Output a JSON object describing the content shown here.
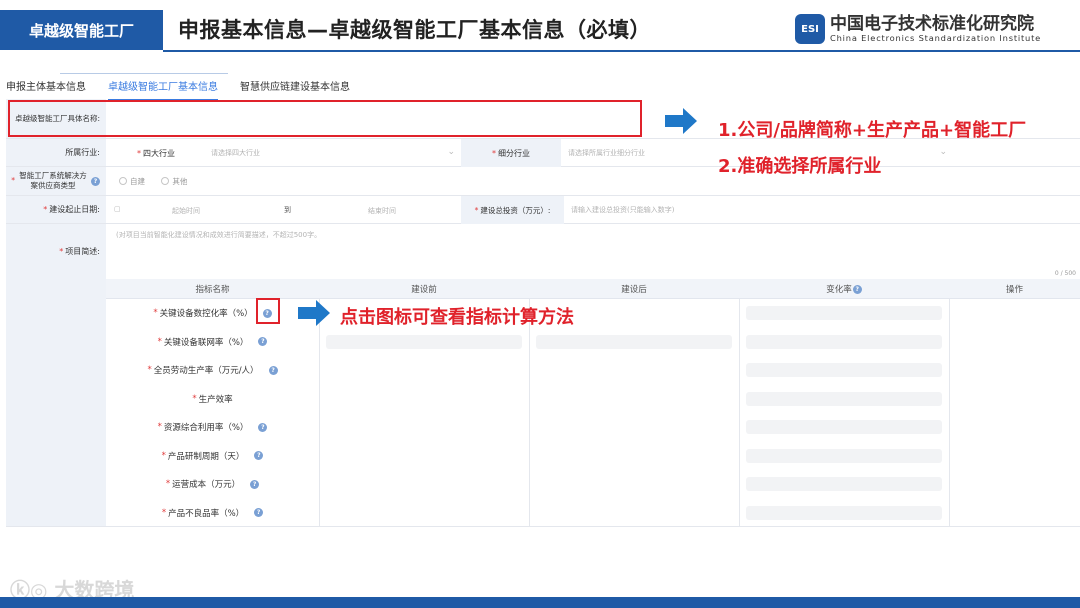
{
  "header": {
    "section_label": "卓越级智能工厂",
    "title": "申报基本信息—卓越级智能工厂基本信息（必填）",
    "logo_badge": "ESI",
    "logo_cn": "中国电子技术标准化研究院",
    "logo_en": "China Electronics Standardization Institute"
  },
  "tabs": [
    {
      "label": "申报主体基本信息",
      "active": false
    },
    {
      "label": "卓越级智能工厂基本信息",
      "active": true
    },
    {
      "label": "智慧供应链建设基本信息",
      "active": false
    }
  ],
  "form": {
    "factory_name_label": "卓越级智能工厂具体名称:",
    "industry_label": "所属行业:",
    "four_industry_label": "四大行业",
    "four_industry_placeholder": "请选择四大行业",
    "sub_industry_label": "细分行业",
    "sub_industry_placeholder": "请选择所属行业细分行业",
    "solution_label": "智能工厂系统解决方案供应商类型",
    "solution_options": [
      "自建",
      "其他"
    ],
    "date_label": "建设起止日期:",
    "date_start_placeholder": "起始时间",
    "date_to": "到",
    "date_end_placeholder": "结束时间",
    "investment_label": "建设总投资（万元）:",
    "investment_placeholder": "请输入建设总投资(只能输入数字)",
    "summary_label": "项目简述:",
    "summary_placeholder": "(对项目当前智能化建设情况和成效进行简要描述，不超过500字。",
    "summary_counter": "0 / 500"
  },
  "annotations": {
    "note1": "1.公司/品牌简称+生产产品+智能工厂",
    "note2": "2.准确选择所属行业",
    "note3": "点击图标可查看指标计算方法"
  },
  "table": {
    "headers": [
      "指标名称",
      "建设前",
      "建设后",
      "变化率",
      "操作"
    ],
    "rows": [
      {
        "name": "关键设备数控化率（%）",
        "help": true
      },
      {
        "name": "关键设备联网率（%）",
        "help": true
      },
      {
        "name": "全员劳动生产率（万元/人）",
        "help": true
      },
      {
        "name": "生产效率",
        "help": false
      },
      {
        "name": "资源综合利用率（%）",
        "help": true
      },
      {
        "name": "产品研制周期（天）",
        "help": true
      },
      {
        "name": "运营成本（万元）",
        "help": true
      },
      {
        "name": "产品不良品率（%）",
        "help": true
      }
    ]
  },
  "watermark": "大数跨境",
  "colors": {
    "brand": "#1f5aa6",
    "annotation": "#e0222b",
    "active_tab": "#3a7be0"
  }
}
